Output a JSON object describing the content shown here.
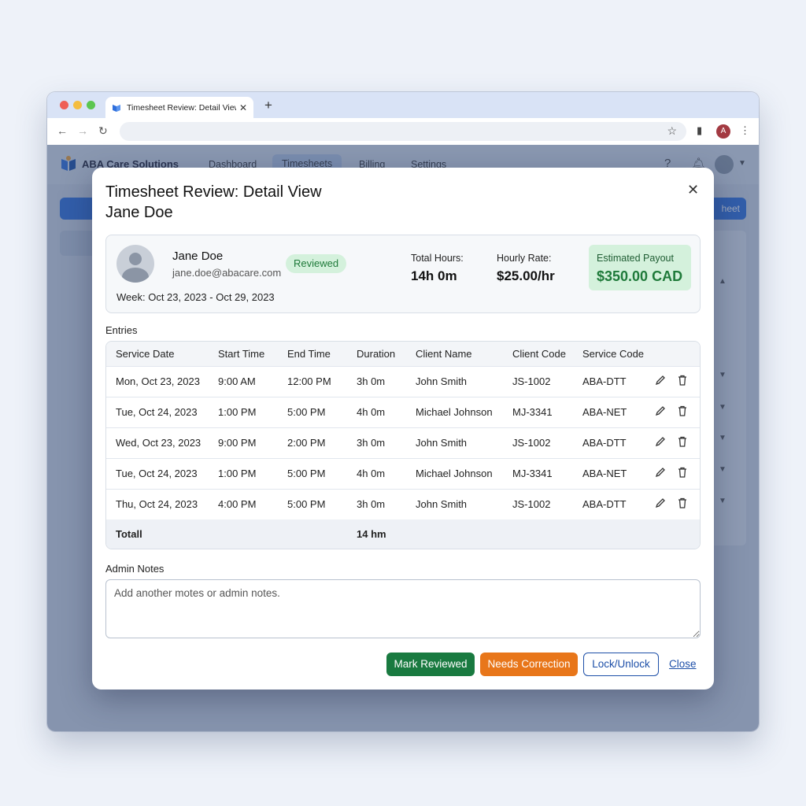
{
  "browser": {
    "tab_title": "Timesheet Review: Detail View",
    "profile_initial": "A"
  },
  "app": {
    "brand": "ABA Care Solutions",
    "nav": [
      "Dashboard",
      "Timesheets",
      "Billing",
      "Settings"
    ],
    "active_nav": "Timesheets",
    "right_button_fragment": "heet"
  },
  "modal": {
    "title": "Timesheet Review: Detail View",
    "subtitle": "Jane Doe",
    "close_icon": "close-icon",
    "employee": {
      "name": "Jane Doe",
      "email": "jane.doe@abacare.com",
      "week": "Week: Oct 23, 2023 - Oct 29, 2023",
      "status": "Reviewed"
    },
    "stats": {
      "total_hours_label": "Total Hours:",
      "total_hours_value": "14h 0m",
      "hourly_rate_label": "Hourly Rate:",
      "hourly_rate_value": "$25.00/hr",
      "payout_label": "Estimated Payout",
      "payout_value": "$350.00 CAD"
    },
    "entries_label": "Entries",
    "columns": [
      "Service Date",
      "Start Time",
      "End Time",
      "Duration",
      "Client Name",
      "Client Code",
      "Service Code"
    ],
    "rows": [
      [
        "Mon, Oct 23, 2023",
        "9:00 AM",
        "12:00 PM",
        "3h 0m",
        "John Smith",
        "JS-1002",
        "ABA-DTT"
      ],
      [
        "Tue, Oct 24, 2023",
        "1:00 PM",
        "5:00 PM",
        "4h 0m",
        "Michael Johnson",
        "MJ-3341",
        "ABA-NET"
      ],
      [
        "Wed, Oct 23, 2023",
        "9:00 PM",
        "2:00 PM",
        "3h 0m",
        "John Smith",
        "JS-1002",
        "ABA-DTT"
      ],
      [
        "Tue, Oct 24, 2023",
        "1:00 PM",
        "5:00 PM",
        "4h 0m",
        "Michael Johnson",
        "MJ-3341",
        "ABA-NET"
      ],
      [
        "Thu, Oct 24, 2023",
        "4:00 PM",
        "5:00 PM",
        "3h 0m",
        "John Smith",
        "JS-1002",
        "ABA-DTT"
      ]
    ],
    "total_label": "Totall",
    "total_value": "14 hm",
    "admin_notes_label": "Admin Notes",
    "admin_notes_placeholder": "Add another motes or admin notes.",
    "buttons": {
      "mark_reviewed": "Mark Reviewed",
      "needs_correction": "Needs Correction",
      "lock_unlock": "Lock/Unlock",
      "close": "Close"
    },
    "colors": {
      "green": "#197a40",
      "orange": "#e8761a",
      "blue": "#1d4fa8",
      "badge_bg": "#d4f1dc"
    }
  }
}
